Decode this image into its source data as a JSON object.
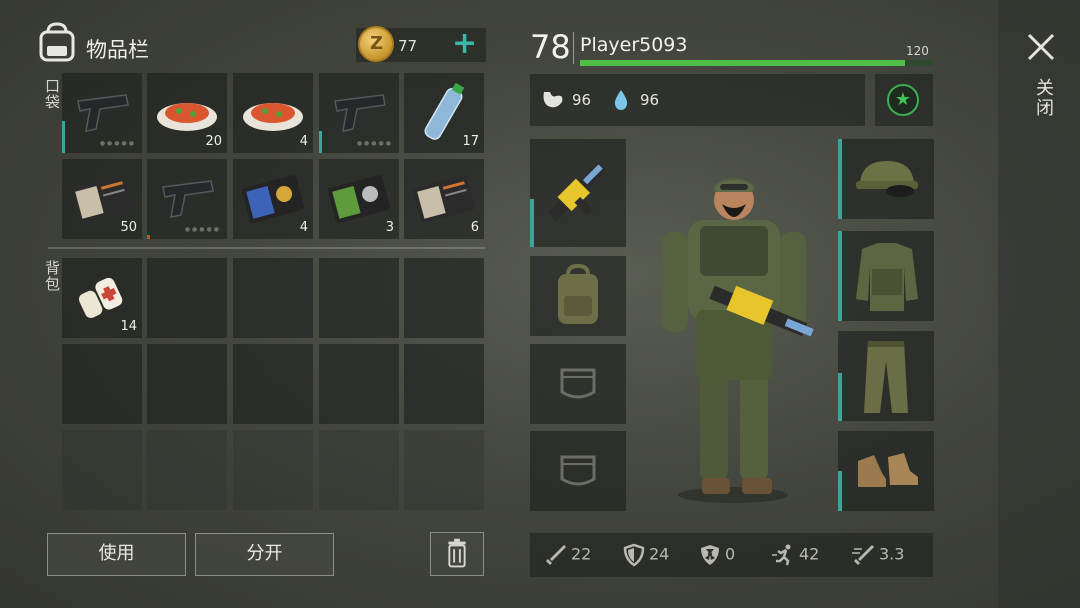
{
  "inventory": {
    "title": "物品栏",
    "coins": "77",
    "pockets_label": "口袋",
    "backpack_label": "背包",
    "pocket_items": [
      {
        "name": "pistol",
        "count": ""
      },
      {
        "name": "food-dish",
        "count": "20"
      },
      {
        "name": "food-dish",
        "count": "4"
      },
      {
        "name": "pistol",
        "count": ""
      },
      {
        "name": "water-bottle",
        "count": "17"
      },
      {
        "name": "id-document",
        "count": "50"
      },
      {
        "name": "pistol",
        "count": ""
      },
      {
        "name": "badge-document-blue",
        "count": "4"
      },
      {
        "name": "badge-document-green",
        "count": "3"
      },
      {
        "name": "id-document",
        "count": "6"
      }
    ],
    "backpack_items": [
      {
        "name": "bandage",
        "count": "14"
      }
    ]
  },
  "buttons": {
    "use": "使用",
    "split": "分开"
  },
  "player": {
    "level": "78",
    "name": "Player5093",
    "max_hp": "120",
    "hp_fraction": 0.92,
    "hunger": "96",
    "thirst": "96"
  },
  "stats": {
    "attack": "22",
    "defense": "24",
    "radiation": "0",
    "speed": "42",
    "attack_speed": "3.3"
  },
  "close_label": "关闭",
  "colors": {
    "accent_teal": "#3aa59a",
    "hp_green": "#4fbf4a",
    "coin_gold": "#c8962d"
  }
}
